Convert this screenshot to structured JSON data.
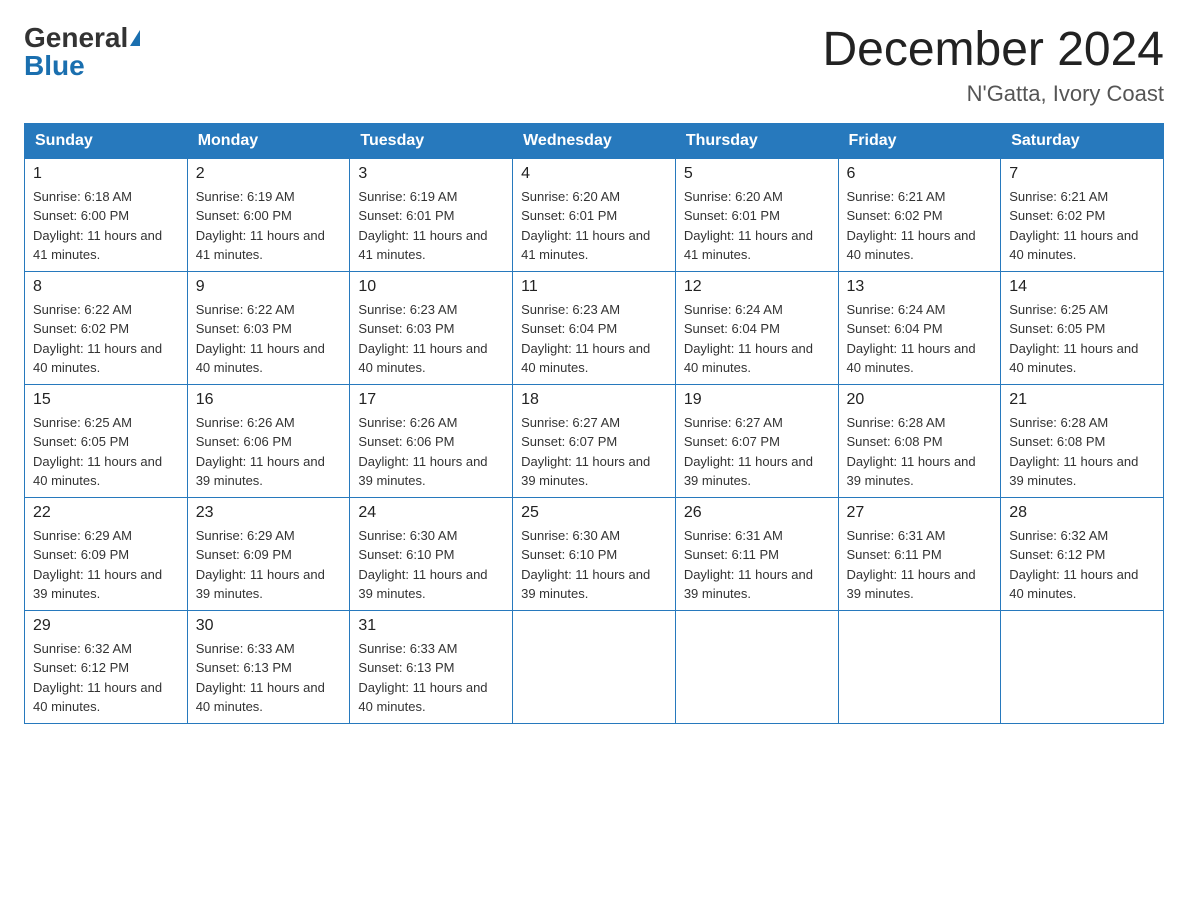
{
  "header": {
    "logo_general": "General",
    "logo_blue": "Blue",
    "month_title": "December 2024",
    "location": "N'Gatta, Ivory Coast"
  },
  "days_of_week": [
    "Sunday",
    "Monday",
    "Tuesday",
    "Wednesday",
    "Thursday",
    "Friday",
    "Saturday"
  ],
  "weeks": [
    [
      {
        "day": "1",
        "sunrise": "6:18 AM",
        "sunset": "6:00 PM",
        "daylight": "11 hours and 41 minutes."
      },
      {
        "day": "2",
        "sunrise": "6:19 AM",
        "sunset": "6:00 PM",
        "daylight": "11 hours and 41 minutes."
      },
      {
        "day": "3",
        "sunrise": "6:19 AM",
        "sunset": "6:01 PM",
        "daylight": "11 hours and 41 minutes."
      },
      {
        "day": "4",
        "sunrise": "6:20 AM",
        "sunset": "6:01 PM",
        "daylight": "11 hours and 41 minutes."
      },
      {
        "day": "5",
        "sunrise": "6:20 AM",
        "sunset": "6:01 PM",
        "daylight": "11 hours and 41 minutes."
      },
      {
        "day": "6",
        "sunrise": "6:21 AM",
        "sunset": "6:02 PM",
        "daylight": "11 hours and 40 minutes."
      },
      {
        "day": "7",
        "sunrise": "6:21 AM",
        "sunset": "6:02 PM",
        "daylight": "11 hours and 40 minutes."
      }
    ],
    [
      {
        "day": "8",
        "sunrise": "6:22 AM",
        "sunset": "6:02 PM",
        "daylight": "11 hours and 40 minutes."
      },
      {
        "day": "9",
        "sunrise": "6:22 AM",
        "sunset": "6:03 PM",
        "daylight": "11 hours and 40 minutes."
      },
      {
        "day": "10",
        "sunrise": "6:23 AM",
        "sunset": "6:03 PM",
        "daylight": "11 hours and 40 minutes."
      },
      {
        "day": "11",
        "sunrise": "6:23 AM",
        "sunset": "6:04 PM",
        "daylight": "11 hours and 40 minutes."
      },
      {
        "day": "12",
        "sunrise": "6:24 AM",
        "sunset": "6:04 PM",
        "daylight": "11 hours and 40 minutes."
      },
      {
        "day": "13",
        "sunrise": "6:24 AM",
        "sunset": "6:04 PM",
        "daylight": "11 hours and 40 minutes."
      },
      {
        "day": "14",
        "sunrise": "6:25 AM",
        "sunset": "6:05 PM",
        "daylight": "11 hours and 40 minutes."
      }
    ],
    [
      {
        "day": "15",
        "sunrise": "6:25 AM",
        "sunset": "6:05 PM",
        "daylight": "11 hours and 40 minutes."
      },
      {
        "day": "16",
        "sunrise": "6:26 AM",
        "sunset": "6:06 PM",
        "daylight": "11 hours and 39 minutes."
      },
      {
        "day": "17",
        "sunrise": "6:26 AM",
        "sunset": "6:06 PM",
        "daylight": "11 hours and 39 minutes."
      },
      {
        "day": "18",
        "sunrise": "6:27 AM",
        "sunset": "6:07 PM",
        "daylight": "11 hours and 39 minutes."
      },
      {
        "day": "19",
        "sunrise": "6:27 AM",
        "sunset": "6:07 PM",
        "daylight": "11 hours and 39 minutes."
      },
      {
        "day": "20",
        "sunrise": "6:28 AM",
        "sunset": "6:08 PM",
        "daylight": "11 hours and 39 minutes."
      },
      {
        "day": "21",
        "sunrise": "6:28 AM",
        "sunset": "6:08 PM",
        "daylight": "11 hours and 39 minutes."
      }
    ],
    [
      {
        "day": "22",
        "sunrise": "6:29 AM",
        "sunset": "6:09 PM",
        "daylight": "11 hours and 39 minutes."
      },
      {
        "day": "23",
        "sunrise": "6:29 AM",
        "sunset": "6:09 PM",
        "daylight": "11 hours and 39 minutes."
      },
      {
        "day": "24",
        "sunrise": "6:30 AM",
        "sunset": "6:10 PM",
        "daylight": "11 hours and 39 minutes."
      },
      {
        "day": "25",
        "sunrise": "6:30 AM",
        "sunset": "6:10 PM",
        "daylight": "11 hours and 39 minutes."
      },
      {
        "day": "26",
        "sunrise": "6:31 AM",
        "sunset": "6:11 PM",
        "daylight": "11 hours and 39 minutes."
      },
      {
        "day": "27",
        "sunrise": "6:31 AM",
        "sunset": "6:11 PM",
        "daylight": "11 hours and 39 minutes."
      },
      {
        "day": "28",
        "sunrise": "6:32 AM",
        "sunset": "6:12 PM",
        "daylight": "11 hours and 40 minutes."
      }
    ],
    [
      {
        "day": "29",
        "sunrise": "6:32 AM",
        "sunset": "6:12 PM",
        "daylight": "11 hours and 40 minutes."
      },
      {
        "day": "30",
        "sunrise": "6:33 AM",
        "sunset": "6:13 PM",
        "daylight": "11 hours and 40 minutes."
      },
      {
        "day": "31",
        "sunrise": "6:33 AM",
        "sunset": "6:13 PM",
        "daylight": "11 hours and 40 minutes."
      },
      null,
      null,
      null,
      null
    ]
  ]
}
